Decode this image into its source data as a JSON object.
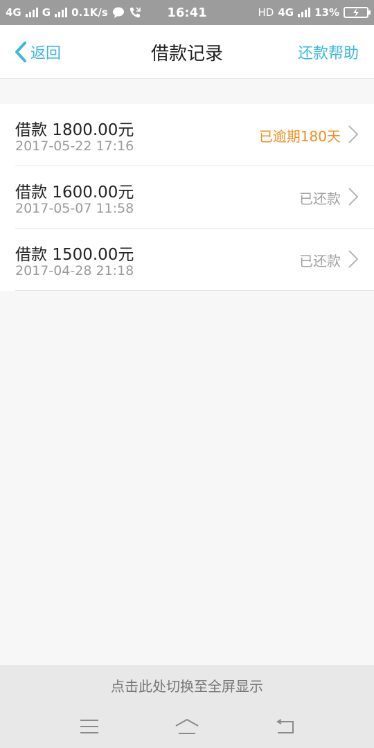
{
  "status_bar": {
    "network1": "4G",
    "network2": "G",
    "speed": "0.1K/s",
    "time": "16:41",
    "hd": "HD",
    "network3": "4G",
    "battery": "13%"
  },
  "nav": {
    "back_label": "返回",
    "title": "借款记录",
    "help_label": "还款帮助"
  },
  "records": [
    {
      "amount": "借款 1800.00元",
      "date": "2017-05-22 17:16",
      "status": "已逾期180天"
    },
    {
      "amount": "借款 1600.00元",
      "date": "2017-05-07 11:58",
      "status": "已还款"
    },
    {
      "amount": "借款 1500.00元",
      "date": "2017-04-28 21:18",
      "status": "已还款"
    }
  ],
  "fullscreen_prompt": "点击此处切换至全屏显示",
  "colors": {
    "accent": "#3cb8dc",
    "overdue": "#f08c1e",
    "muted": "#9a9a9a"
  }
}
